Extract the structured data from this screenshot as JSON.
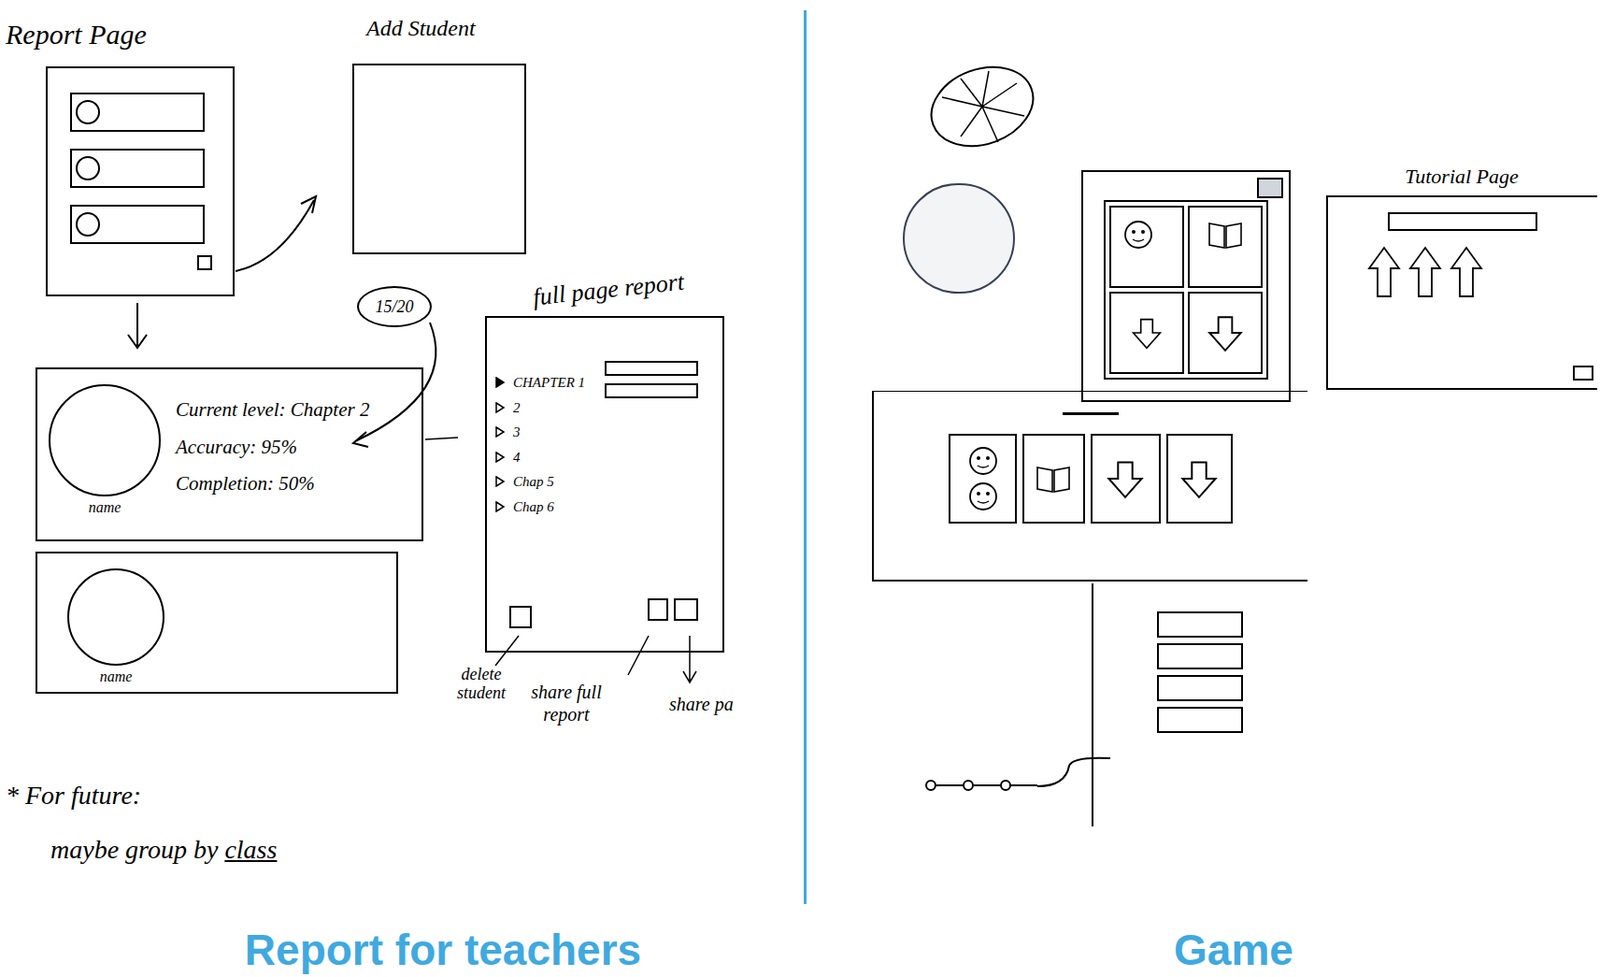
{
  "report": {
    "title": "Report Page",
    "add_student": {
      "title": "Add Student"
    },
    "student_list": [
      {
        "selected": false
      },
      {
        "selected": false
      },
      {
        "selected": false
      }
    ],
    "detail": {
      "current_level": "Current level: Chapter 2",
      "accuracy": "Accuracy: 95%",
      "completion": "Completion: 50%",
      "name": "name",
      "score": "15/20"
    },
    "second_card": {
      "name": "name"
    },
    "full_report": {
      "title": "full page report",
      "chapters": [
        {
          "label": "CHAPTER 1",
          "expanded": true
        },
        {
          "label": "2",
          "expanded": false
        },
        {
          "label": "3",
          "expanded": false
        },
        {
          "label": "4",
          "expanded": false
        },
        {
          "label": "Chap 5",
          "expanded": false
        },
        {
          "label": "Chap 6",
          "expanded": false
        }
      ],
      "delete_label": "delete student",
      "share_full_label": "share full report",
      "share_page_label": "share pa"
    },
    "note": {
      "title": "* For future:",
      "body": "maybe group by",
      "emphasis": "class"
    }
  },
  "game": {
    "tutorial": {
      "title": "Tutorial Page"
    },
    "buttons": [
      {
        "selected": false
      },
      {
        "selected": false
      },
      {
        "selected": false
      },
      {
        "selected": false
      }
    ],
    "nodes": [
      {
        "selected": false
      },
      {
        "selected": false
      },
      {
        "selected": false
      }
    ]
  },
  "sections": [
    {
      "label": "Report for teachers"
    },
    {
      "label": "Game"
    }
  ]
}
